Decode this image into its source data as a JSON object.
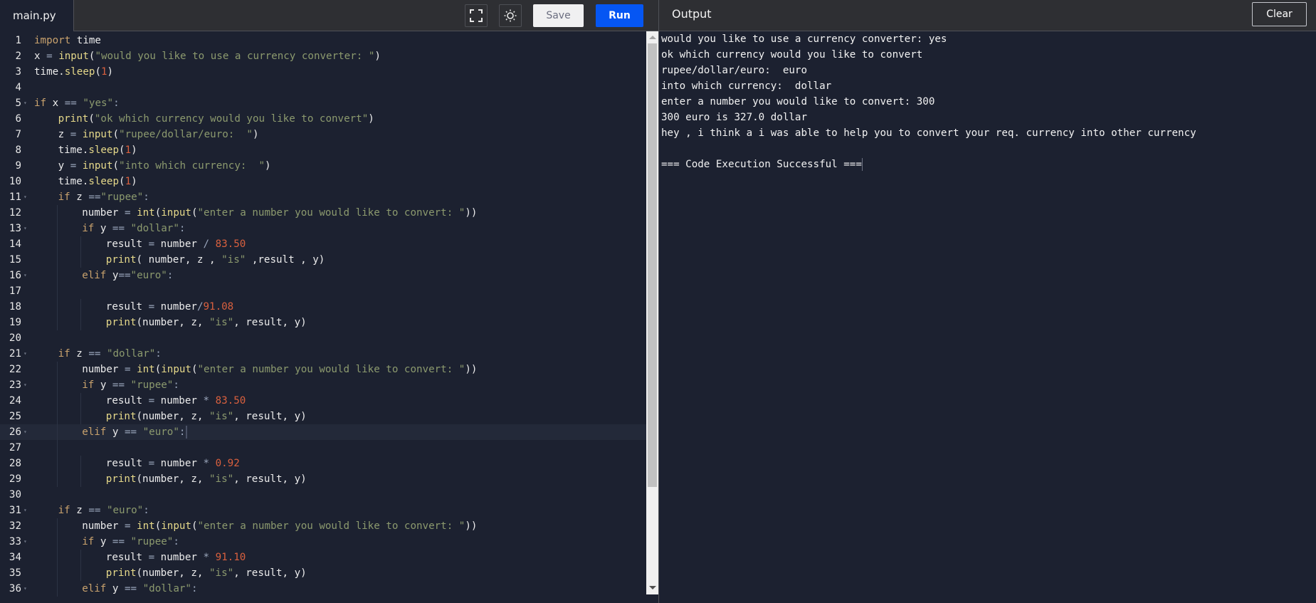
{
  "editor": {
    "file_tab": "main.py",
    "toolbar": {
      "fullscreen_icon": "fullscreen-icon",
      "theme_icon": "sun-icon",
      "save_label": "Save",
      "run_label": "Run"
    },
    "active_line": 26,
    "lines": [
      {
        "n": "1",
        "fold": false,
        "indent": 0,
        "tokens": [
          [
            "kw",
            "import"
          ],
          [
            "id",
            " time"
          ]
        ]
      },
      {
        "n": "2",
        "fold": false,
        "indent": 0,
        "tokens": [
          [
            "id",
            "x "
          ],
          [
            "op",
            "="
          ],
          [
            "id",
            " "
          ],
          [
            "fn",
            "input"
          ],
          [
            "id",
            "("
          ],
          [
            "str",
            "\"would you like to use a currency converter: \""
          ],
          [
            "id",
            ")"
          ]
        ]
      },
      {
        "n": "3",
        "fold": false,
        "indent": 0,
        "tokens": [
          [
            "id",
            "time."
          ],
          [
            "fn",
            "sleep"
          ],
          [
            "id",
            "("
          ],
          [
            "num",
            "1"
          ],
          [
            "id",
            ")"
          ]
        ]
      },
      {
        "n": "4",
        "fold": false,
        "indent": 0,
        "tokens": []
      },
      {
        "n": "5",
        "fold": true,
        "indent": 0,
        "tokens": [
          [
            "kw",
            "if"
          ],
          [
            "id",
            " x "
          ],
          [
            "op",
            "=="
          ],
          [
            "id",
            " "
          ],
          [
            "str",
            "\"yes\""
          ],
          [
            "op",
            ":"
          ]
        ]
      },
      {
        "n": "6",
        "fold": false,
        "indent": 1,
        "tokens": [
          [
            "fn",
            "print"
          ],
          [
            "id",
            "("
          ],
          [
            "str",
            "\"ok which currency would you like to convert\""
          ],
          [
            "id",
            ")"
          ]
        ]
      },
      {
        "n": "7",
        "fold": false,
        "indent": 1,
        "tokens": [
          [
            "id",
            "z "
          ],
          [
            "op",
            "="
          ],
          [
            "id",
            " "
          ],
          [
            "fn",
            "input"
          ],
          [
            "id",
            "("
          ],
          [
            "str",
            "\"rupee/dollar/euro:  \""
          ],
          [
            "id",
            ")"
          ]
        ]
      },
      {
        "n": "8",
        "fold": false,
        "indent": 1,
        "tokens": [
          [
            "id",
            "time."
          ],
          [
            "fn",
            "sleep"
          ],
          [
            "id",
            "("
          ],
          [
            "num",
            "1"
          ],
          [
            "id",
            ")"
          ]
        ]
      },
      {
        "n": "9",
        "fold": false,
        "indent": 1,
        "tokens": [
          [
            "id",
            "y "
          ],
          [
            "op",
            "="
          ],
          [
            "id",
            " "
          ],
          [
            "fn",
            "input"
          ],
          [
            "id",
            "("
          ],
          [
            "str",
            "\"into which currency:  \""
          ],
          [
            "id",
            ")"
          ]
        ]
      },
      {
        "n": "10",
        "fold": false,
        "indent": 1,
        "tokens": [
          [
            "id",
            "time."
          ],
          [
            "fn",
            "sleep"
          ],
          [
            "id",
            "("
          ],
          [
            "num",
            "1"
          ],
          [
            "id",
            ")"
          ]
        ]
      },
      {
        "n": "11",
        "fold": true,
        "indent": 1,
        "tokens": [
          [
            "kw",
            "if"
          ],
          [
            "id",
            " z "
          ],
          [
            "op",
            "=="
          ],
          [
            "str",
            "\"rupee\""
          ],
          [
            "op",
            ":"
          ]
        ]
      },
      {
        "n": "12",
        "fold": false,
        "indent": 2,
        "tokens": [
          [
            "id",
            "number "
          ],
          [
            "op",
            "="
          ],
          [
            "id",
            " "
          ],
          [
            "fn",
            "int"
          ],
          [
            "id",
            "("
          ],
          [
            "fn",
            "input"
          ],
          [
            "id",
            "("
          ],
          [
            "str",
            "\"enter a number you would like to convert: \""
          ],
          [
            "id",
            "))"
          ]
        ]
      },
      {
        "n": "13",
        "fold": true,
        "indent": 2,
        "tokens": [
          [
            "kw",
            "if"
          ],
          [
            "id",
            " y "
          ],
          [
            "op",
            "=="
          ],
          [
            "id",
            " "
          ],
          [
            "str",
            "\"dollar\""
          ],
          [
            "op",
            ":"
          ]
        ]
      },
      {
        "n": "14",
        "fold": false,
        "indent": 3,
        "tokens": [
          [
            "id",
            "result "
          ],
          [
            "op",
            "="
          ],
          [
            "id",
            " number "
          ],
          [
            "op",
            "/"
          ],
          [
            "id",
            " "
          ],
          [
            "num",
            "83.50"
          ]
        ]
      },
      {
        "n": "15",
        "fold": false,
        "indent": 3,
        "tokens": [
          [
            "fn",
            "print"
          ],
          [
            "id",
            "( number, z , "
          ],
          [
            "str",
            "\"is\""
          ],
          [
            "id",
            " ,result , y)"
          ]
        ]
      },
      {
        "n": "16",
        "fold": true,
        "indent": 2,
        "tokens": [
          [
            "kw",
            "elif"
          ],
          [
            "id",
            " y"
          ],
          [
            "op",
            "=="
          ],
          [
            "str",
            "\"euro\""
          ],
          [
            "op",
            ":"
          ]
        ]
      },
      {
        "n": "17",
        "fold": false,
        "indent": 0,
        "tokens": []
      },
      {
        "n": "18",
        "fold": false,
        "indent": 3,
        "tokens": [
          [
            "id",
            "result "
          ],
          [
            "op",
            "="
          ],
          [
            "id",
            " number"
          ],
          [
            "op",
            "/"
          ],
          [
            "num",
            "91.08"
          ]
        ]
      },
      {
        "n": "19",
        "fold": false,
        "indent": 3,
        "tokens": [
          [
            "fn",
            "print"
          ],
          [
            "id",
            "(number, z, "
          ],
          [
            "str",
            "\"is\""
          ],
          [
            "id",
            ", result, y)"
          ]
        ]
      },
      {
        "n": "20",
        "fold": false,
        "indent": 0,
        "tokens": []
      },
      {
        "n": "21",
        "fold": true,
        "indent": 1,
        "tokens": [
          [
            "kw",
            "if"
          ],
          [
            "id",
            " z "
          ],
          [
            "op",
            "=="
          ],
          [
            "id",
            " "
          ],
          [
            "str",
            "\"dollar\""
          ],
          [
            "op",
            ":"
          ]
        ]
      },
      {
        "n": "22",
        "fold": false,
        "indent": 2,
        "tokens": [
          [
            "id",
            "number "
          ],
          [
            "op",
            "="
          ],
          [
            "id",
            " "
          ],
          [
            "fn",
            "int"
          ],
          [
            "id",
            "("
          ],
          [
            "fn",
            "input"
          ],
          [
            "id",
            "("
          ],
          [
            "str",
            "\"enter a number you would like to convert: \""
          ],
          [
            "id",
            "))"
          ]
        ]
      },
      {
        "n": "23",
        "fold": true,
        "indent": 2,
        "tokens": [
          [
            "kw",
            "if"
          ],
          [
            "id",
            " y "
          ],
          [
            "op",
            "=="
          ],
          [
            "id",
            " "
          ],
          [
            "str",
            "\"rupee\""
          ],
          [
            "op",
            ":"
          ]
        ]
      },
      {
        "n": "24",
        "fold": false,
        "indent": 3,
        "tokens": [
          [
            "id",
            "result "
          ],
          [
            "op",
            "="
          ],
          [
            "id",
            " number "
          ],
          [
            "op",
            "*"
          ],
          [
            "id",
            " "
          ],
          [
            "num",
            "83.50"
          ]
        ]
      },
      {
        "n": "25",
        "fold": false,
        "indent": 3,
        "tokens": [
          [
            "fn",
            "print"
          ],
          [
            "id",
            "(number, z, "
          ],
          [
            "str",
            "\"is\""
          ],
          [
            "id",
            ", result, y)"
          ]
        ]
      },
      {
        "n": "26",
        "fold": true,
        "indent": 2,
        "tokens": [
          [
            "kw",
            "elif"
          ],
          [
            "id",
            " y "
          ],
          [
            "op",
            "=="
          ],
          [
            "id",
            " "
          ],
          [
            "str",
            "\"euro\""
          ],
          [
            "op",
            ":"
          ]
        ]
      },
      {
        "n": "27",
        "fold": false,
        "indent": 0,
        "tokens": []
      },
      {
        "n": "28",
        "fold": false,
        "indent": 3,
        "tokens": [
          [
            "id",
            "result "
          ],
          [
            "op",
            "="
          ],
          [
            "id",
            " number "
          ],
          [
            "op",
            "*"
          ],
          [
            "id",
            " "
          ],
          [
            "num",
            "0.92"
          ]
        ]
      },
      {
        "n": "29",
        "fold": false,
        "indent": 3,
        "tokens": [
          [
            "fn",
            "print"
          ],
          [
            "id",
            "(number, z, "
          ],
          [
            "str",
            "\"is\""
          ],
          [
            "id",
            ", result, y)"
          ]
        ]
      },
      {
        "n": "30",
        "fold": false,
        "indent": 0,
        "tokens": []
      },
      {
        "n": "31",
        "fold": true,
        "indent": 1,
        "tokens": [
          [
            "kw",
            "if"
          ],
          [
            "id",
            " z "
          ],
          [
            "op",
            "=="
          ],
          [
            "id",
            " "
          ],
          [
            "str",
            "\"euro\""
          ],
          [
            "op",
            ":"
          ]
        ]
      },
      {
        "n": "32",
        "fold": false,
        "indent": 2,
        "tokens": [
          [
            "id",
            "number "
          ],
          [
            "op",
            "="
          ],
          [
            "id",
            " "
          ],
          [
            "fn",
            "int"
          ],
          [
            "id",
            "("
          ],
          [
            "fn",
            "input"
          ],
          [
            "id",
            "("
          ],
          [
            "str",
            "\"enter a number you would like to convert: \""
          ],
          [
            "id",
            "))"
          ]
        ]
      },
      {
        "n": "33",
        "fold": true,
        "indent": 2,
        "tokens": [
          [
            "kw",
            "if"
          ],
          [
            "id",
            " y "
          ],
          [
            "op",
            "=="
          ],
          [
            "id",
            " "
          ],
          [
            "str",
            "\"rupee\""
          ],
          [
            "op",
            ":"
          ]
        ]
      },
      {
        "n": "34",
        "fold": false,
        "indent": 3,
        "tokens": [
          [
            "id",
            "result "
          ],
          [
            "op",
            "="
          ],
          [
            "id",
            " number "
          ],
          [
            "op",
            "*"
          ],
          [
            "id",
            " "
          ],
          [
            "num",
            "91.10"
          ]
        ]
      },
      {
        "n": "35",
        "fold": false,
        "indent": 3,
        "tokens": [
          [
            "fn",
            "print"
          ],
          [
            "id",
            "(number, z, "
          ],
          [
            "str",
            "\"is\""
          ],
          [
            "id",
            ", result, y)"
          ]
        ]
      },
      {
        "n": "36",
        "fold": true,
        "indent": 2,
        "tokens": [
          [
            "kw",
            "elif"
          ],
          [
            "id",
            " y "
          ],
          [
            "op",
            "=="
          ],
          [
            "id",
            " "
          ],
          [
            "str",
            "\"dollar\""
          ],
          [
            "op",
            ":"
          ]
        ]
      }
    ]
  },
  "output": {
    "title": "Output",
    "clear_label": "Clear",
    "lines": [
      "would you like to use a currency converter: yes",
      "ok which currency would you like to convert",
      "rupee/dollar/euro:  euro",
      "into which currency:  dollar",
      "enter a number you would like to convert: 300",
      "300 euro is 327.0 dollar",
      "hey , i think a i was able to help you to convert your req. currency into other currency",
      "",
      "=== Code Execution Successful ==="
    ]
  },
  "colors": {
    "accent_run": "#0556f3",
    "editor_bg": "#1c2130",
    "header_bg": "#2e2f33",
    "keyword": "#c9a26d",
    "function": "#e6d98a",
    "string": "#8c9a6e",
    "number": "#d9603e"
  }
}
